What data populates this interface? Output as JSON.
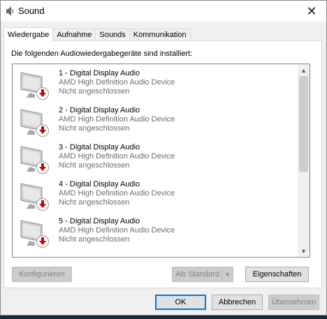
{
  "window": {
    "title": "Sound",
    "close_label": "✕"
  },
  "tabs": [
    {
      "label": "Wiedergabe",
      "active": true
    },
    {
      "label": "Aufnahme",
      "active": false
    },
    {
      "label": "Sounds",
      "active": false
    },
    {
      "label": "Kommunikation",
      "active": false
    }
  ],
  "panel": {
    "heading": "Die folgenden Audiowiedergabegeräte sind installiert:"
  },
  "devices": [
    {
      "name": "1 - Digital Display Audio",
      "driver": "AMD High Definition Audio Device",
      "status": "Nicht angeschlossen"
    },
    {
      "name": "2 - Digital Display Audio",
      "driver": "AMD High Definition Audio Device",
      "status": "Nicht angeschlossen"
    },
    {
      "name": "3 - Digital Display Audio",
      "driver": "AMD High Definition Audio Device",
      "status": "Nicht angeschlossen"
    },
    {
      "name": "4 - Digital Display Audio",
      "driver": "AMD High Definition Audio Device",
      "status": "Nicht angeschlossen"
    },
    {
      "name": "5 - Digital Display Audio",
      "driver": "AMD High Definition Audio Device",
      "status": "Nicht angeschlossen"
    }
  ],
  "buttons": {
    "configure": "Konfigurieren",
    "set_default": "Als Standard",
    "properties": "Eigenschaften",
    "ok": "OK",
    "cancel": "Abbrechen",
    "apply": "Übernehmen"
  },
  "icons": {
    "device": "monitor-speaker-icon",
    "status": "red-down-arrow-icon",
    "scroll_up": "chevron-up-icon",
    "scroll_down": "chevron-down-icon"
  },
  "colors": {
    "status_red": "#d00000",
    "default_button_border": "#0078d7",
    "secondary_text": "#6d6d6d"
  }
}
